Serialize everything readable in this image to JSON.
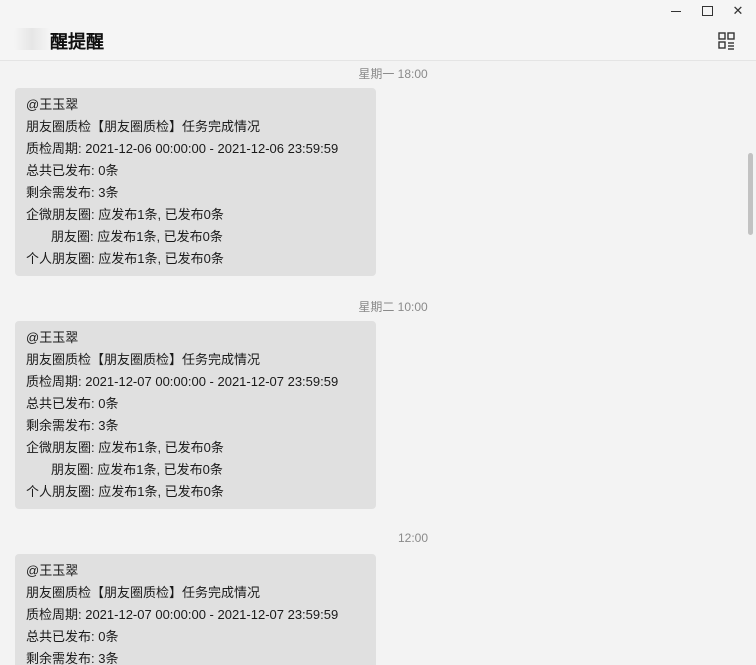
{
  "window": {
    "title": "醒提醒",
    "controls": {
      "minimize": "minimize",
      "maximize": "maximize",
      "close": "✕"
    }
  },
  "messages": [
    {
      "timestamp": "星期一 18:00",
      "lines": [
        "@王玉翠",
        "朋友圈质检【朋友圈质检】任务完成情况",
        "质检周期: 2021-12-06 00:00:00 - 2021-12-06 23:59:59",
        "总共已发布: 0条",
        "剩余需发布: 3条",
        "企微朋友圈: 应发布1条, 已发布0条",
        "朋友圈: 应发布1条, 已发布0条",
        "个人朋友圈: 应发布1条, 已发布0条"
      ]
    },
    {
      "timestamp": "星期二 10:00",
      "lines": [
        "@王玉翠",
        "朋友圈质检【朋友圈质检】任务完成情况",
        "质检周期: 2021-12-07 00:00:00 - 2021-12-07 23:59:59",
        "总共已发布: 0条",
        "剩余需发布: 3条",
        "企微朋友圈: 应发布1条, 已发布0条",
        "朋友圈: 应发布1条, 已发布0条",
        "个人朋友圈: 应发布1条, 已发布0条"
      ]
    },
    {
      "timestamp": "12:00",
      "lines": [
        "@王玉翠",
        "朋友圈质检【朋友圈质检】任务完成情况",
        "质检周期: 2021-12-07 00:00:00 - 2021-12-07 23:59:59",
        "总共已发布: 0条",
        "剩余需发布: 3条"
      ]
    }
  ],
  "colors": {
    "background": "#f3f3f3",
    "bubble": "#e0e0e0",
    "timestamp": "#8a8a8a",
    "text": "#1a1a1a"
  }
}
